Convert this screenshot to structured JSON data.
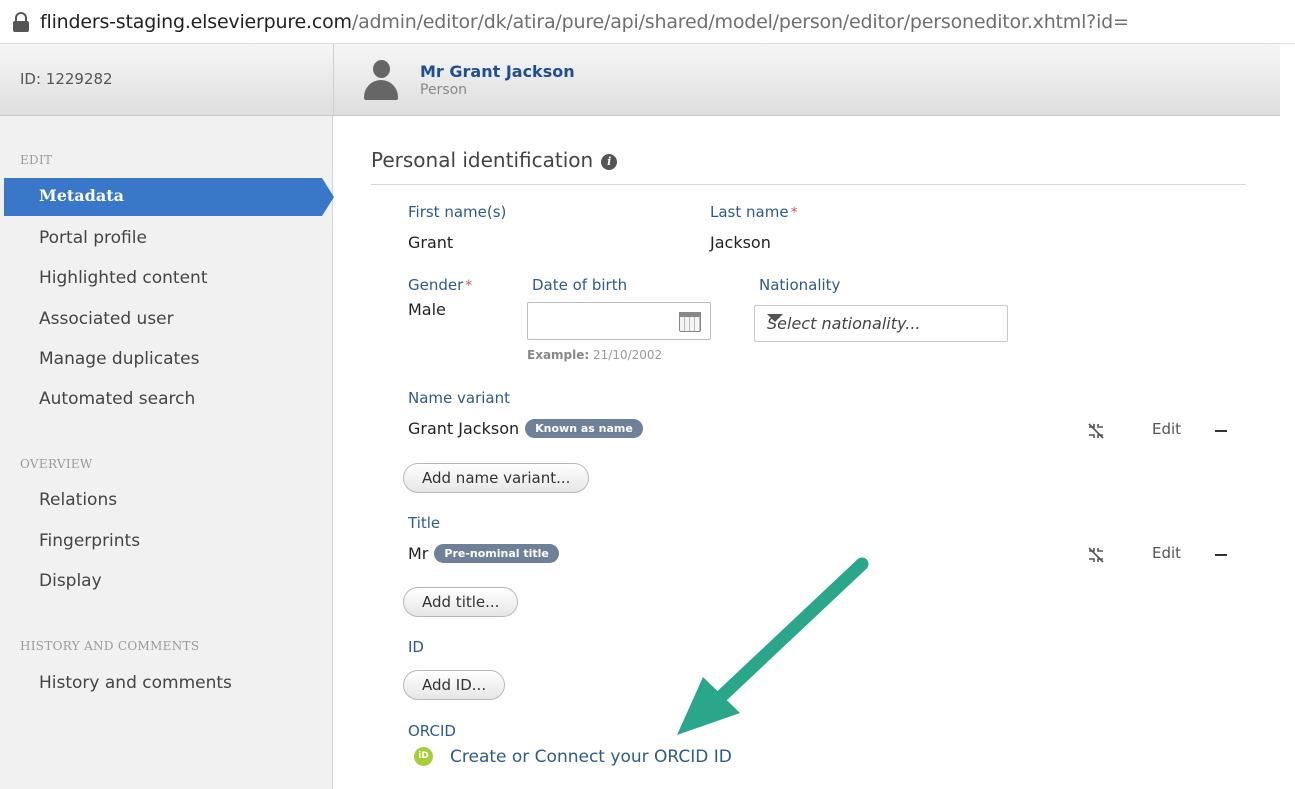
{
  "browser": {
    "url_host": "flinders-staging.elsevierpure.com",
    "url_path": "/admin/editor/dk/atira/pure/api/shared/model/person/editor/personeditor.xhtml?id="
  },
  "header": {
    "id_label": "ID: 1229282",
    "person_name": "Mr Grant Jackson",
    "person_type": "Person"
  },
  "sidebar": {
    "edit_heading": "EDIT",
    "edit_items": [
      {
        "label": "Metadata",
        "active": true
      },
      {
        "label": "Portal profile"
      },
      {
        "label": "Highlighted content"
      },
      {
        "label": "Associated user"
      },
      {
        "label": "Manage duplicates"
      },
      {
        "label": "Automated search"
      }
    ],
    "overview_heading": "OVERVIEW",
    "overview_items": [
      {
        "label": "Relations"
      },
      {
        "label": "Fingerprints"
      },
      {
        "label": "Display"
      }
    ],
    "history_heading": "HISTORY AND COMMENTS",
    "history_items": [
      {
        "label": "History and comments"
      }
    ]
  },
  "main": {
    "section_title": "Personal identification",
    "info_icon": "i",
    "first_name_label": "First name(s)",
    "first_name_value": "Grant",
    "last_name_label": "Last name",
    "last_name_value": "Jackson",
    "required_mark": "*",
    "gender_label": "Gender",
    "gender_value": "Male",
    "dob_label": "Date of birth",
    "dob_value": "",
    "dob_example_prefix": "Example:",
    "dob_example_value": "21/10/2002",
    "nationality_label": "Nationality",
    "nationality_placeholder": "Select nationality...",
    "name_variant_label": "Name variant",
    "name_variant_value": "Grant Jackson",
    "name_variant_badge": "Known as name",
    "add_name_variant_button": "Add name variant...",
    "title_label": "Title",
    "title_value": "Mr",
    "title_badge": "Pre-nominal title",
    "add_title_button": "Add title...",
    "id_label": "ID",
    "add_id_button": "Add ID...",
    "orcid_label": "ORCID",
    "orcid_icon_text": "iD",
    "orcid_link": "Create or Connect your ORCID ID",
    "edit_link": "Edit",
    "arrow_color": "#2aa68a"
  }
}
